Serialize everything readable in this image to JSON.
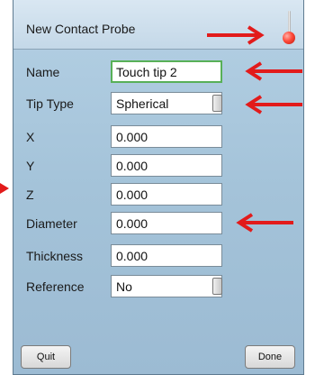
{
  "dialog": {
    "title": "New Contact Probe",
    "fields": [
      {
        "label": "Name",
        "value": "Touch tip 2"
      },
      {
        "label": "Tip Type",
        "value": "Spherical"
      },
      {
        "label": "X",
        "value": "0.000"
      },
      {
        "label": "Y",
        "value": "0.000"
      },
      {
        "label": "Z",
        "value": "0.000"
      },
      {
        "label": "Diameter",
        "value": "0.000"
      },
      {
        "label": "Thickness",
        "value": "0.000"
      },
      {
        "label": "Reference",
        "value": "No"
      }
    ],
    "quit_label": "Quit",
    "done_label": "Done"
  },
  "colors": {
    "arrow": "#e21b1b",
    "panel": "#a4c3d9",
    "header": "#c4d8e8",
    "active_border": "#58b058"
  }
}
